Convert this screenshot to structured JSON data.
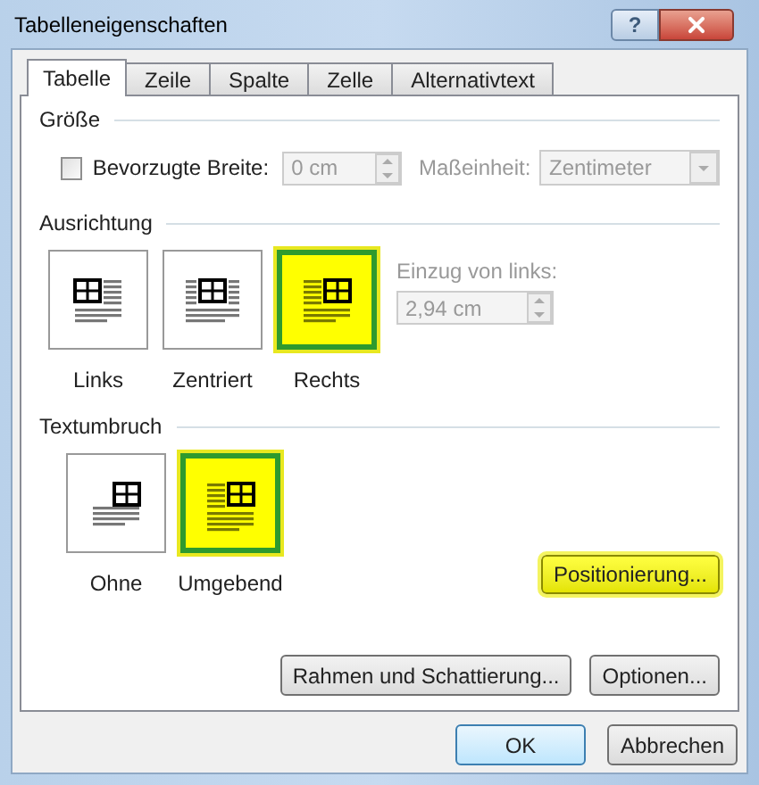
{
  "window": {
    "title": "Tabelleneigenschaften",
    "help": "?"
  },
  "tabs": [
    {
      "label": "Tabelle",
      "selected": true
    },
    {
      "label": "Zeile",
      "selected": false
    },
    {
      "label": "Spalte",
      "selected": false
    },
    {
      "label": "Zelle",
      "selected": false
    },
    {
      "label": "Alternativtext",
      "selected": false
    }
  ],
  "size": {
    "heading": "Größe",
    "preferred_width": {
      "label": "Bevorzugte Breite:",
      "checked": false,
      "value": "0 cm",
      "disabled": true
    },
    "unit": {
      "label": "Maßeinheit:",
      "value": "Zentimeter",
      "disabled": true
    }
  },
  "alignment": {
    "heading": "Ausrichtung",
    "options": [
      {
        "label": "Links",
        "kind": "left",
        "selected": false
      },
      {
        "label": "Zentriert",
        "kind": "center",
        "selected": false
      },
      {
        "label": "Rechts",
        "kind": "right",
        "selected": true
      }
    ],
    "indent": {
      "label": "Einzug von links:",
      "value": "2,94 cm",
      "disabled": true
    }
  },
  "text_wrapping": {
    "heading": "Textumbruch",
    "options": [
      {
        "label": "Ohne",
        "kind": "none",
        "selected": false
      },
      {
        "label": "Umgebend",
        "kind": "around",
        "selected": true
      }
    ],
    "positioning_button": {
      "label": "Positionierung...",
      "highlighted": true
    }
  },
  "panel_buttons": [
    "Rahmen und Schattierung...",
    "Optionen..."
  ],
  "buttons": [
    {
      "label": "OK",
      "default": true
    },
    {
      "label": "Abbrechen",
      "default": false
    }
  ]
}
